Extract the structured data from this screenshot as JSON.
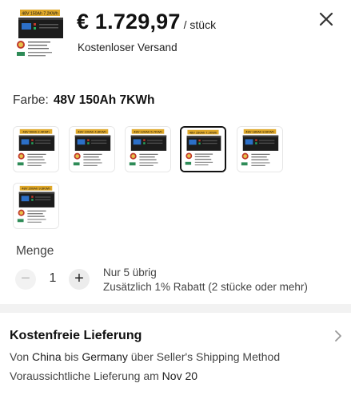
{
  "product": {
    "price": "€ 1.729,97",
    "unit": "/ stück",
    "shipping": "Kostenloser Versand",
    "thumbnail_caption": "48V 150Ah 7.2KWh"
  },
  "color": {
    "label": "Farbe:",
    "selected": "48V 150Ah 7KWh",
    "variants": [
      {
        "caption": "48V 50Ah 2.4KWh",
        "selected": false
      },
      {
        "caption": "48V 100Ah 4.8KWh",
        "selected": false
      },
      {
        "caption": "48V 120Ah 5.7KWh",
        "selected": false
      },
      {
        "caption": "48V 150Ah 7.2KWh",
        "selected": true
      },
      {
        "caption": "48V 180Ah 8.6KWh",
        "selected": false
      },
      {
        "caption": "48V 200Ah 9.6KWh",
        "selected": false
      }
    ]
  },
  "quantity": {
    "label": "Menge",
    "value": "1",
    "minus": "−",
    "plus": "+",
    "stock": "Nur 5 übrig",
    "discount": "Zusätzlich 1% Rabatt (2 stücke oder mehr)"
  },
  "delivery": {
    "title": "Kostenfreie Lieferung",
    "from_label": "Von",
    "origin": "China",
    "to_label": "bis",
    "destination": "Germany",
    "method": "über Seller's Shipping Method",
    "eta_label": "Voraussichtliche Lieferung am",
    "eta_date": "Nov 20"
  },
  "icons": {
    "close": "close-icon",
    "chevron": "chevron-right-icon",
    "battery": "battery-product-icon"
  }
}
